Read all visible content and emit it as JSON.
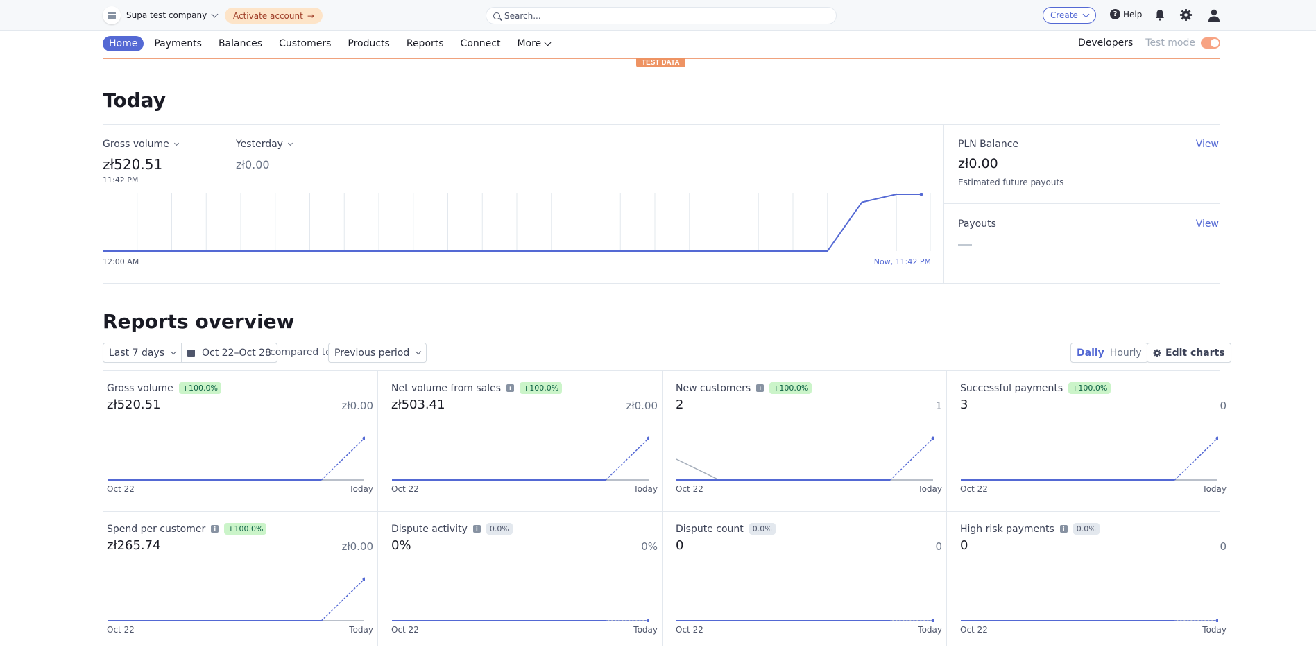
{
  "topbar": {
    "company_name": "Supa test company",
    "activate_label": "Activate account",
    "search_placeholder": "Search...",
    "create_label": "Create",
    "help_label": "Help",
    "icons": [
      "store-icon",
      "arrow-right-icon",
      "search-icon",
      "question-icon",
      "bell-icon",
      "gear-icon",
      "user-icon"
    ]
  },
  "nav": {
    "items": [
      {
        "label": "Home",
        "active": true
      },
      {
        "label": "Payments"
      },
      {
        "label": "Balances"
      },
      {
        "label": "Customers"
      },
      {
        "label": "Products"
      },
      {
        "label": "Reports"
      },
      {
        "label": "Connect"
      },
      {
        "label": "More"
      }
    ],
    "developers_label": "Developers",
    "test_mode_label": "Test mode",
    "test_mode_on": true,
    "test_data_badge": "TEST DATA"
  },
  "today": {
    "title": "Today",
    "metric_label": "Gross volume",
    "metric_value": "zł520.51",
    "metric_time": "11:42 PM",
    "compare_label": "Yesterday",
    "compare_value": "zł0.00",
    "x_start": "12:00 AM",
    "x_end": "Now, 11:42 PM",
    "series": [
      0,
      0,
      0,
      0,
      0,
      0,
      0,
      0,
      0,
      0,
      0,
      0,
      0,
      0,
      0,
      0,
      0,
      0,
      0,
      0,
      0,
      0,
      0.86,
      1.0,
      1.0
    ],
    "balance": {
      "title": "PLN Balance",
      "value": "zł0.00",
      "note": "Estimated future payouts",
      "view_label": "View"
    },
    "payouts": {
      "title": "Payouts",
      "value": "—",
      "view_label": "View"
    }
  },
  "reports": {
    "title": "Reports overview",
    "range_label": "Last 7 days",
    "date_range": "Oct 22–Oct 28",
    "compared_to": "compared to",
    "compare_period": "Previous period",
    "daily_label": "Daily",
    "hourly_label": "Hourly",
    "edit_charts_label": "Edit charts",
    "x_start": "Oct 22",
    "x_end": "Today",
    "cards": [
      {
        "title": "Gross volume",
        "info": false,
        "change": "+100.0%",
        "positive": true,
        "value": "zł520.51",
        "previous": "zł0.00",
        "current": [
          0,
          0,
          0,
          0,
          0,
          0,
          1
        ],
        "prior": [
          0,
          0,
          0,
          0,
          0,
          0,
          0
        ]
      },
      {
        "title": "Net volume from sales",
        "info": true,
        "change": "+100.0%",
        "positive": true,
        "value": "zł503.41",
        "previous": "zł0.00",
        "current": [
          0,
          0,
          0,
          0,
          0,
          0,
          1
        ],
        "prior": [
          0,
          0,
          0,
          0,
          0,
          0,
          0
        ]
      },
      {
        "title": "New customers",
        "info": true,
        "change": "+100.0%",
        "positive": true,
        "value": "2",
        "previous": "1",
        "current": [
          0,
          0,
          0,
          0,
          0,
          0,
          2
        ],
        "prior": [
          1,
          0,
          0,
          0,
          0,
          0,
          0
        ]
      },
      {
        "title": "Successful payments",
        "info": false,
        "change": "+100.0%",
        "positive": true,
        "value": "3",
        "previous": "0",
        "current": [
          0,
          0,
          0,
          0,
          0,
          0,
          3
        ],
        "prior": [
          0,
          0,
          0,
          0,
          0,
          0,
          0
        ]
      },
      {
        "title": "Spend per customer",
        "info": true,
        "change": "+100.0%",
        "positive": true,
        "value": "zł265.74",
        "previous": "zł0.00",
        "current": [
          0,
          0,
          0,
          0,
          0,
          0,
          1
        ],
        "prior": [
          0,
          0,
          0,
          0,
          0,
          0,
          0
        ]
      },
      {
        "title": "Dispute activity",
        "info": true,
        "change": "0.0%",
        "positive": false,
        "value": "0%",
        "previous": "0%",
        "current": [
          0,
          0,
          0,
          0,
          0,
          0,
          0
        ],
        "prior": [
          0,
          0,
          0,
          0,
          0,
          0,
          0
        ]
      },
      {
        "title": "Dispute count",
        "info": false,
        "change": "0.0%",
        "positive": false,
        "value": "0",
        "previous": "0",
        "current": [
          0,
          0,
          0,
          0,
          0,
          0,
          0
        ],
        "prior": [
          0,
          0,
          0,
          0,
          0,
          0,
          0
        ]
      },
      {
        "title": "High risk payments",
        "info": true,
        "change": "0.0%",
        "positive": false,
        "value": "0",
        "previous": "0",
        "current": [
          0,
          0,
          0,
          0,
          0,
          0,
          0
        ],
        "prior": [
          0,
          0,
          0,
          0,
          0,
          0,
          0
        ]
      }
    ]
  },
  "colors": {
    "accent": "#5469d4",
    "test_mode": "#ee9363",
    "positive_badge": "#cbf4c9",
    "neutral_badge": "#e3e8ee",
    "prior_series": "#a3acb9"
  }
}
